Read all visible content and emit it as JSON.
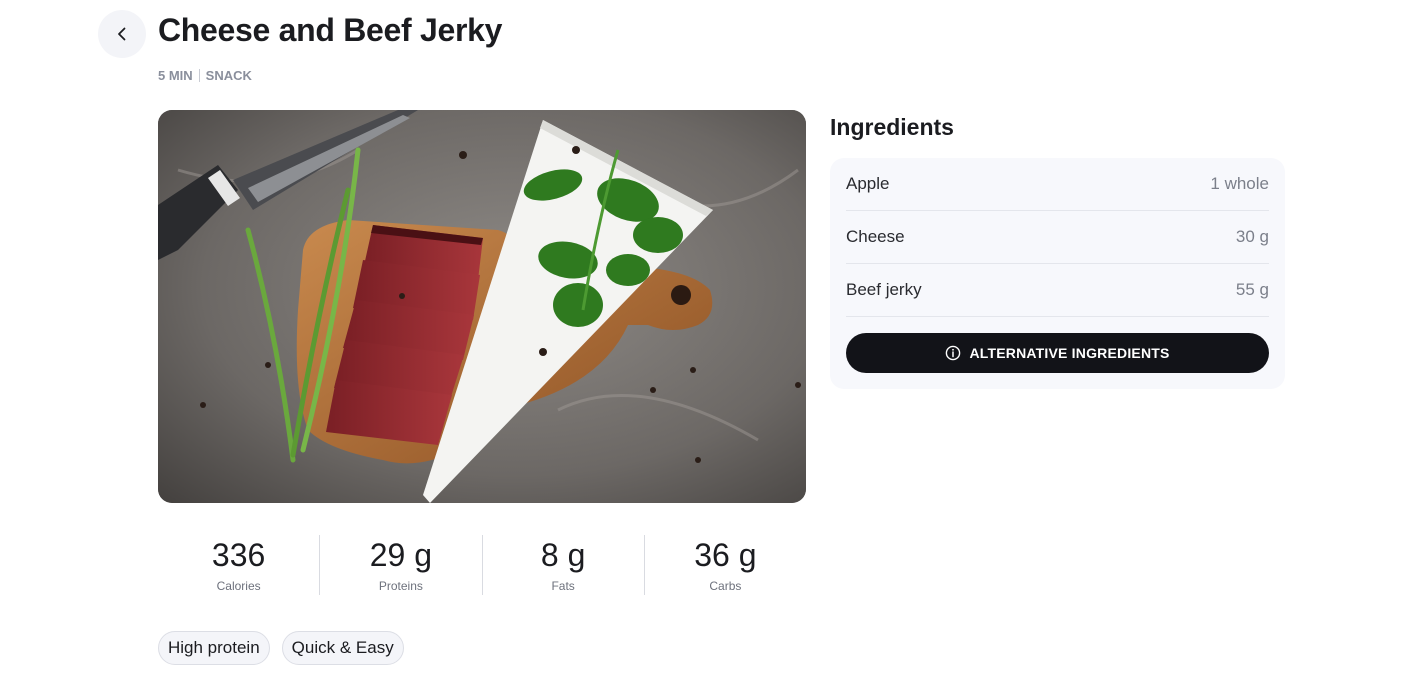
{
  "recipe": {
    "title": "Cheese and Beef Jerky",
    "time": "5 MIN",
    "category": "SNACK"
  },
  "nutrition": [
    {
      "value": "336",
      "label": "Calories"
    },
    {
      "value": "29 g",
      "label": "Proteins"
    },
    {
      "value": "8 g",
      "label": "Fats"
    },
    {
      "value": "36 g",
      "label": "Carbs"
    }
  ],
  "tags": [
    "High protein",
    "Quick & Easy"
  ],
  "ingredients": {
    "title": "Ingredients",
    "items": [
      {
        "name": "Apple",
        "qty": "1 whole"
      },
      {
        "name": "Cheese",
        "qty": "30 g"
      },
      {
        "name": "Beef jerky",
        "qty": "55 g"
      }
    ],
    "alt_button_label": "ALTERNATIVE INGREDIENTS"
  },
  "icons": {
    "back": "chevron-left-icon",
    "info": "info-icon"
  },
  "colors": {
    "primary_button": "#121318",
    "card_bg": "#f7f8fc",
    "muted_text": "#8a8f9c"
  }
}
